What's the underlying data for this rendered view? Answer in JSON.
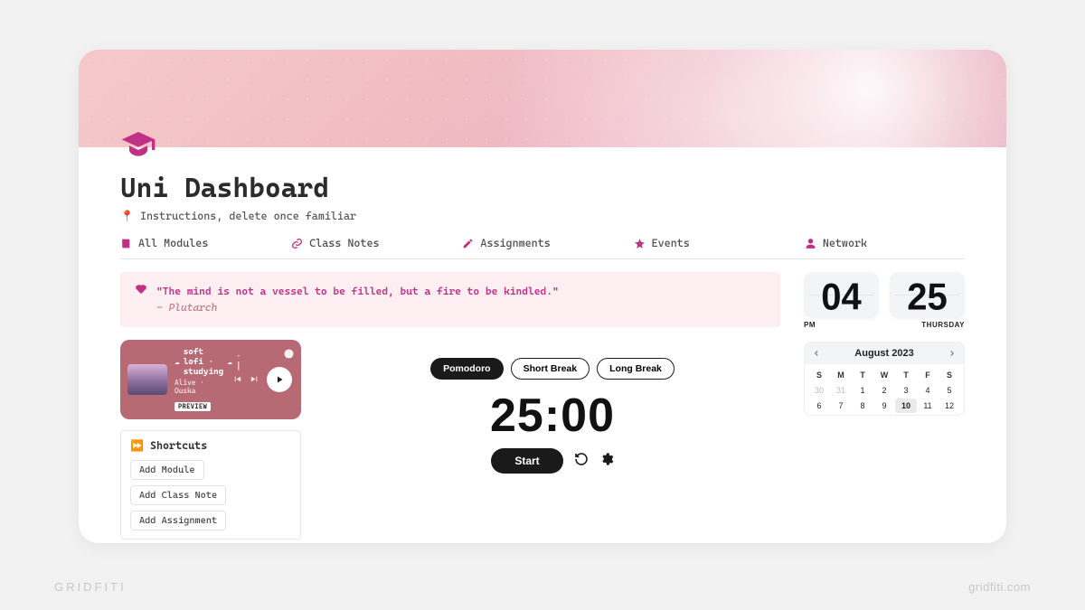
{
  "page": {
    "title": "Uni Dashboard",
    "instructions": "Instructions, delete once familiar"
  },
  "nav": [
    {
      "label": "All Modules",
      "icon": "book"
    },
    {
      "label": "Class Notes",
      "icon": "link"
    },
    {
      "label": "Assignments",
      "icon": "pencil"
    },
    {
      "label": "Events",
      "icon": "star"
    },
    {
      "label": "Network",
      "icon": "user"
    }
  ],
  "quote": {
    "text": "\"The mind is not a vessel to be filled, but a fire to be kindled.\"",
    "author": "- Plutarch"
  },
  "music": {
    "title": "soft lofi · studying",
    "subtitle": "Alive · Ouska",
    "badge": "PREVIEW"
  },
  "shortcuts": {
    "header": "Shortcuts",
    "items": [
      "Add Module",
      "Add Class Note",
      "Add Assignment"
    ]
  },
  "pomodoro": {
    "tabs": [
      "Pomodoro",
      "Short Break",
      "Long Break"
    ],
    "active_tab": 0,
    "time": "25:00",
    "start_label": "Start"
  },
  "clock": {
    "hour": "04",
    "minute": "25",
    "ampm": "PM",
    "dayname": "THURSDAY"
  },
  "calendar": {
    "month_label": "August 2023",
    "dow": [
      "S",
      "M",
      "T",
      "W",
      "T",
      "F",
      "S"
    ],
    "leading_muted": [
      30,
      31
    ],
    "days": [
      1,
      2,
      3,
      4,
      5,
      6,
      7,
      8,
      9,
      10,
      11,
      12
    ],
    "today": 10
  },
  "footer": {
    "brand": "GRIDFITI",
    "url": "gridfiti.com"
  }
}
